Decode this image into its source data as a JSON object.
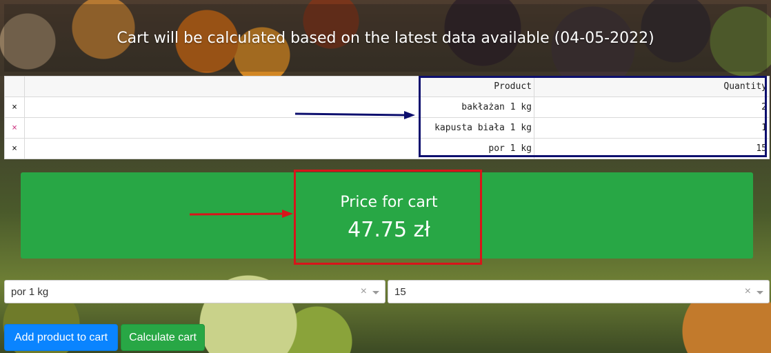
{
  "header": {
    "title": "Cart will be calculated based on the latest data available (04-05-2022)"
  },
  "table": {
    "columns": [
      "Product",
      "Quantity"
    ],
    "rows": [
      {
        "product": "bakłażan 1 kg",
        "quantity": "2"
      },
      {
        "product": "kapusta biała 1 kg",
        "quantity": "1"
      },
      {
        "product": "por 1 kg",
        "quantity": "15"
      }
    ],
    "remove_glyph": "×"
  },
  "price": {
    "label": "Price for cart",
    "value": "47.75 zł"
  },
  "product_select": {
    "value": "por 1 kg",
    "clear_glyph": "×"
  },
  "quantity_select": {
    "value": "15",
    "clear_glyph": "×"
  },
  "buttons": {
    "add_label": "Add product to cart",
    "calculate_label": "Calculate cart"
  },
  "colors": {
    "price_panel": "#28a745",
    "add_button": "#0a84ff",
    "calculate_button": "#28a745",
    "annotation_blue": "#0d0f6e",
    "annotation_red": "#d9141a"
  },
  "icons": [
    "close-icon",
    "chevron-down-icon",
    "arrow-right-icon"
  ]
}
